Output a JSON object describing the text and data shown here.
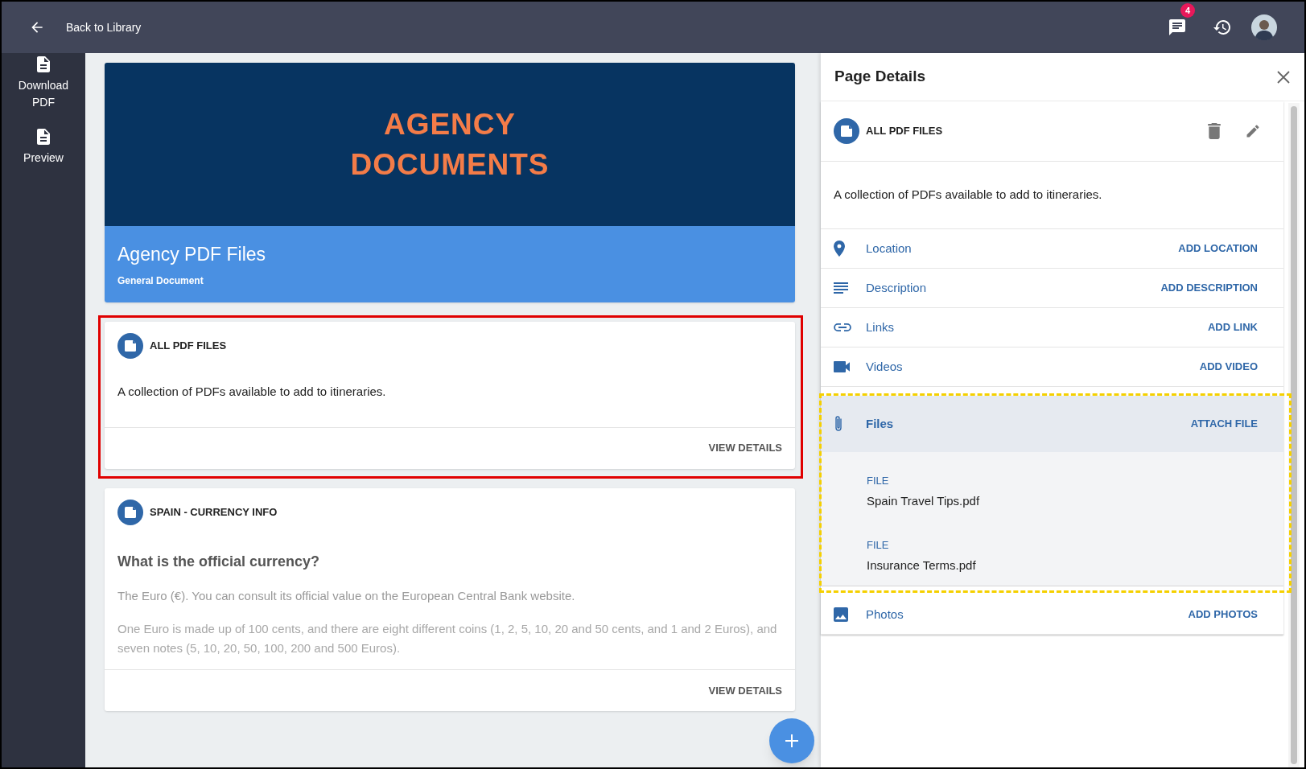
{
  "topbar": {
    "back_label": "Back to Library",
    "notification_count": "4"
  },
  "sidebar": {
    "items": [
      {
        "label": "Download PDF"
      },
      {
        "label": "Preview"
      }
    ]
  },
  "banner": {
    "image_lines": [
      "AGENCY",
      "DOCUMENTS"
    ],
    "title": "Agency PDF Files",
    "subtitle": "General Document"
  },
  "cards": [
    {
      "title": "ALL PDF FILES",
      "highlighted": true,
      "body": [
        {
          "kind": "text",
          "text": "A collection of PDFs available to add to itineraries."
        }
      ],
      "action": "VIEW DETAILS"
    },
    {
      "title": "SPAIN - CURRENCY INFO",
      "highlighted": false,
      "body": [
        {
          "kind": "heading",
          "text": "What is the official currency?"
        },
        {
          "kind": "faded",
          "text": "The Euro (€). You can consult its official value on the European Central Bank website."
        },
        {
          "kind": "faint",
          "text": "One Euro is made up of 100 cents, and there are eight different coins (1, 2, 5, 10, 20 and 50 cents, and 1 and 2 Euros), and seven notes (5, 10, 20, 50, 100, 200 and 500 Euros)."
        }
      ],
      "action": "VIEW DETAILS"
    }
  ],
  "details": {
    "title": "Page Details",
    "item_title": "ALL PDF FILES",
    "description": "A collection of PDFs available to add to itineraries.",
    "sections": [
      {
        "kind": "location",
        "label": "Location",
        "action": "ADD LOCATION",
        "expanded": false,
        "highlighted": false
      },
      {
        "kind": "description",
        "label": "Description",
        "action": "ADD DESCRIPTION",
        "expanded": false,
        "highlighted": false
      },
      {
        "kind": "links",
        "label": "Links",
        "action": "ADD LINK",
        "expanded": false,
        "highlighted": false
      },
      {
        "kind": "videos",
        "label": "Videos",
        "action": "ADD VIDEO",
        "expanded": false,
        "highlighted": false
      },
      {
        "kind": "files",
        "label": "Files",
        "action": "ATTACH FILE",
        "expanded": true,
        "highlighted": true,
        "items": [
          {
            "type": "FILE",
            "name": "Spain Travel Tips.pdf"
          },
          {
            "type": "FILE",
            "name": "Insurance Terms.pdf"
          }
        ]
      },
      {
        "kind": "photos",
        "label": "Photos",
        "action": "ADD PHOTOS",
        "expanded": false,
        "highlighted": false
      }
    ]
  }
}
